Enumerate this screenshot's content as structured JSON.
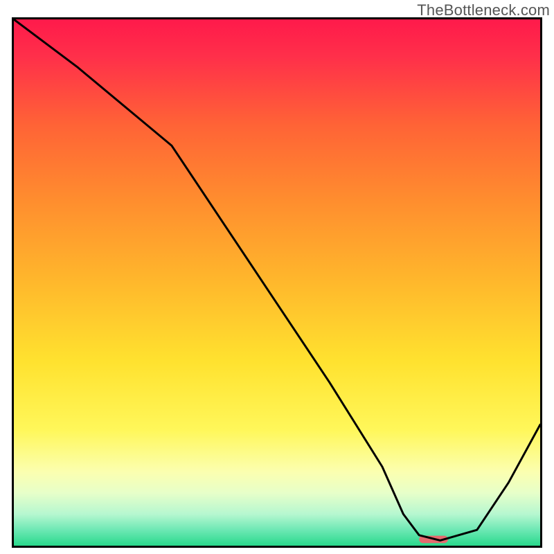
{
  "watermark": "TheBottleneck.com",
  "chart_data": {
    "type": "line",
    "title": "",
    "xlabel": "",
    "ylabel": "",
    "xlim": [
      0,
      100
    ],
    "ylim": [
      0,
      100
    ],
    "grid": false,
    "background_gradient": {
      "stops": [
        {
          "offset": 0.0,
          "color": "#ff1a4b"
        },
        {
          "offset": 0.07,
          "color": "#ff2f4a"
        },
        {
          "offset": 0.2,
          "color": "#ff6336"
        },
        {
          "offset": 0.35,
          "color": "#ff8f2e"
        },
        {
          "offset": 0.5,
          "color": "#ffb82c"
        },
        {
          "offset": 0.65,
          "color": "#ffe22f"
        },
        {
          "offset": 0.78,
          "color": "#fff75a"
        },
        {
          "offset": 0.86,
          "color": "#fbffb0"
        },
        {
          "offset": 0.9,
          "color": "#e7ffc9"
        },
        {
          "offset": 0.94,
          "color": "#b6f7d0"
        },
        {
          "offset": 0.97,
          "color": "#6de8b4"
        },
        {
          "offset": 1.0,
          "color": "#29d98c"
        }
      ]
    },
    "series": [
      {
        "name": "bottleneck-curve",
        "x": [
          0,
          12,
          24,
          30,
          40,
          50,
          60,
          70,
          74,
          77,
          81,
          88,
          94,
          100
        ],
        "y": [
          100,
          91,
          81,
          76,
          61,
          46,
          31,
          15,
          6,
          2,
          1,
          3,
          12,
          23
        ]
      }
    ],
    "optimal_marker": {
      "x_range": [
        77,
        82.5
      ],
      "y": 1.2,
      "color": "#e56a6e",
      "bar_height_pct": 1.4
    }
  }
}
